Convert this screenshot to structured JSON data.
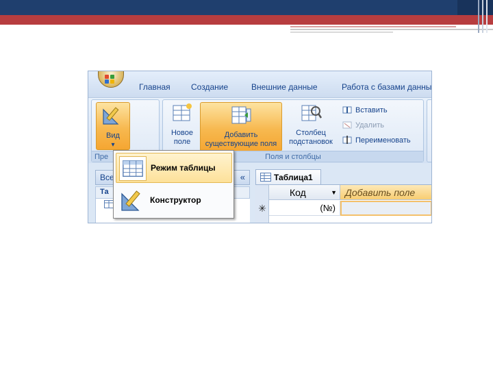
{
  "ribbon_tabs": [
    "Главная",
    "Создание",
    "Внешние данные",
    "Работа с базами данных"
  ],
  "view_button": {
    "label": "Вид",
    "arrow": "▾"
  },
  "group_prefix_label": "Пре",
  "new_field": {
    "line1": "Новое",
    "line2": "поле"
  },
  "add_existing": {
    "line1": "Добавить",
    "line2": "существующие поля"
  },
  "lookup_column": {
    "line1": "Столбец",
    "line2": "подстановок"
  },
  "small_buttons": {
    "insert": "Вставить",
    "delete": "Удалить",
    "rename": "Переименовать"
  },
  "group_fields_label": "Поля и столбцы",
  "nav_pane": {
    "header": "Все",
    "collapse": "«",
    "sub_label": "Та"
  },
  "document_tab": "Таблица1",
  "columns": {
    "code": "Код",
    "add_field": "Добавить поле"
  },
  "new_row": {
    "marker": "✳",
    "code_value": "(№)"
  },
  "menu": {
    "datasheet_view": "Режим таблицы",
    "design_view": "Конструктор"
  },
  "colors": {
    "slide_bar": "#1f3f6e",
    "slide_accent": "#b73d3f",
    "ribbon_text": "#15428b",
    "highlight": "#f7b950"
  }
}
